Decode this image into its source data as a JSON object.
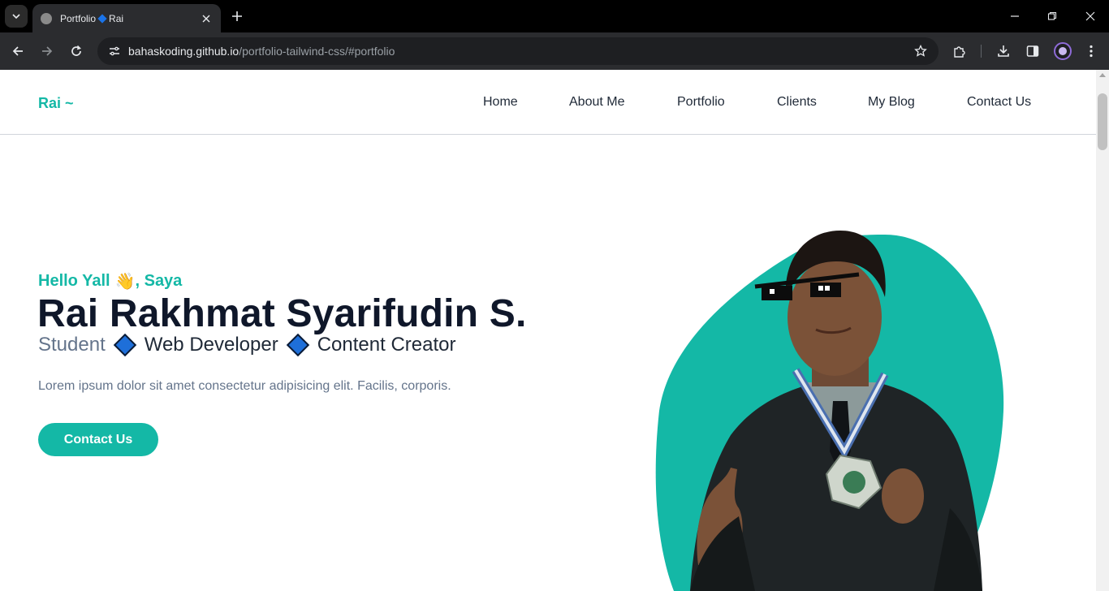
{
  "browser": {
    "tab_title_left": "Portfolio",
    "tab_title_right": "Rai",
    "url_host": "bahaskoding.github.io",
    "url_path": "/portfolio-tailwind-css/#portfolio"
  },
  "site": {
    "brand": "Rai ~",
    "nav": [
      "Home",
      "About Me",
      "Portfolio",
      "Clients",
      "My Blog",
      "Contact Us"
    ]
  },
  "hero": {
    "hello": "Hello Yall",
    "hello_suffix": ", Saya",
    "name": "Rai Rakhmat Syarifudin S.",
    "roles": [
      "Student",
      "Web Developer",
      "Content Creator"
    ],
    "description": "Lorem ipsum dolor sit amet consectetur adipisicing elit. Facilis, corporis.",
    "button": "Contact Us"
  },
  "colors": {
    "accent": "#14b8a6",
    "heading": "#0f172a",
    "muted": "#64748b",
    "diamond": "#1e6fd9"
  }
}
